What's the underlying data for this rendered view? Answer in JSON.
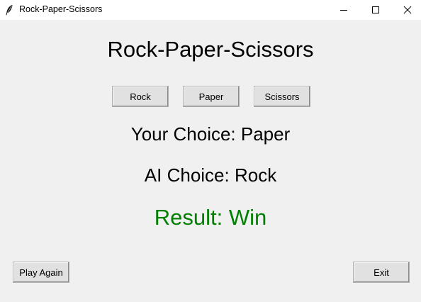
{
  "window": {
    "title": "Rock-Paper-Scissors",
    "icon": "feather-icon"
  },
  "heading": "Rock-Paper-Scissors",
  "choices": {
    "rock_label": "Rock",
    "paper_label": "Paper",
    "scissors_label": "Scissors"
  },
  "status": {
    "your_choice": "Your Choice: Paper",
    "ai_choice": "AI Choice: Rock",
    "result": "Result: Win",
    "result_color": "#008000"
  },
  "footer": {
    "play_again_label": "Play Again",
    "exit_label": "Exit"
  }
}
